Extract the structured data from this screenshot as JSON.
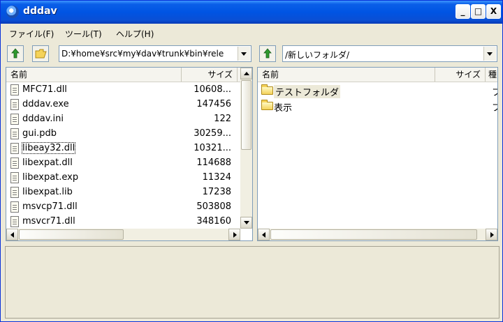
{
  "window": {
    "title": "dddav"
  },
  "titlebar_buttons": {
    "minimize": "_",
    "maximize": "□",
    "close": "X"
  },
  "menu": [
    {
      "label": "ファイル(F)"
    },
    {
      "label": "ツール(T)"
    },
    {
      "label": "ヘルプ(H)"
    }
  ],
  "left": {
    "path": "D:¥home¥src¥my¥dav¥trunk¥bin¥rele",
    "columns": {
      "name": "名前",
      "size": "サイズ"
    },
    "files": [
      {
        "name": "MFC71.dll",
        "size": "10608..."
      },
      {
        "name": "dddav.exe",
        "size": "147456"
      },
      {
        "name": "dddav.ini",
        "size": "122"
      },
      {
        "name": "gui.pdb",
        "size": "30259..."
      },
      {
        "name": "libeay32.dll",
        "size": "10321..."
      },
      {
        "name": "libexpat.dll",
        "size": "114688"
      },
      {
        "name": "libexpat.exp",
        "size": "11324"
      },
      {
        "name": "libexpat.lib",
        "size": "17238"
      },
      {
        "name": "msvcp71.dll",
        "size": "503808"
      },
      {
        "name": "msvcr71.dll",
        "size": "348160"
      }
    ]
  },
  "right": {
    "path": "/新しいフォルダ/",
    "columns": {
      "name": "名前",
      "size": "サイズ",
      "type": "種"
    },
    "items": [
      {
        "name": "テストフォルダ",
        "type": "フ"
      },
      {
        "name": "表示",
        "type": "フ"
      }
    ]
  },
  "colors": {
    "titlebar": "#0054e3",
    "face": "#ece9d8",
    "border": "#7f9db9"
  }
}
